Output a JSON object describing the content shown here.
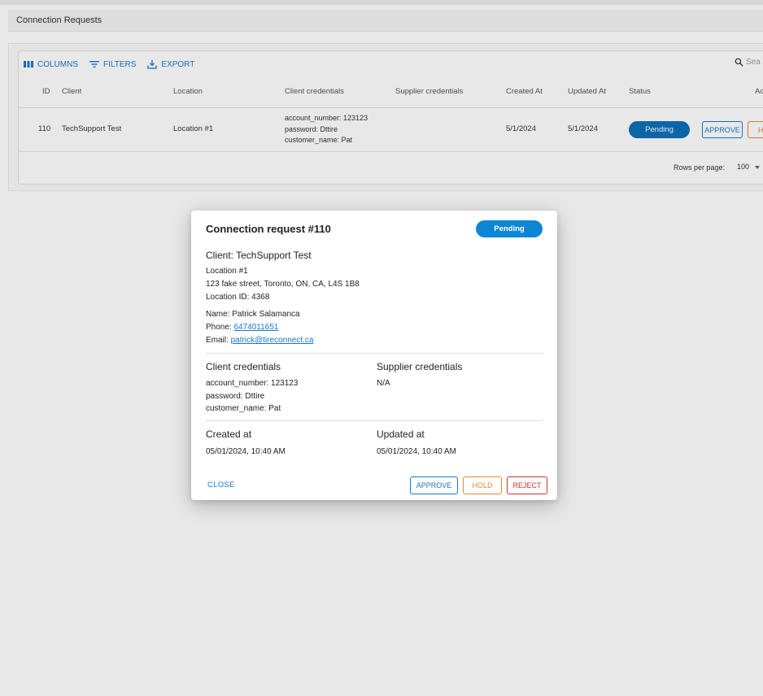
{
  "page": {
    "title": "Connection Requests"
  },
  "toolbar": {
    "columns": "COLUMNS",
    "filters": "FILTERS",
    "export": "EXPORT",
    "search_placeholder": "Sea"
  },
  "table": {
    "headers": {
      "id": "ID",
      "client": "Client",
      "location": "Location",
      "client_credentials": "Client credentials",
      "supplier_credentials": "Supplier credentials",
      "created_at": "Created At",
      "updated_at": "Updated At",
      "status": "Status",
      "actions": "Ac"
    },
    "row": {
      "id": "110",
      "client": "TechSupport Test",
      "location": "Location #1",
      "cred_line1": "account_number: 123123",
      "cred_line2": "password: Dttire",
      "cred_line3": "customer_name: Pat",
      "created_at": "5/1/2024",
      "updated_at": "5/1/2024",
      "status": "Pending",
      "approve": "APPROVE",
      "hold": "H"
    },
    "footer": {
      "rows_per_page_label": "Rows per page:",
      "rows_per_page_value": "100"
    }
  },
  "dialog": {
    "title": "Connection request #110",
    "status": "Pending",
    "client": "Client: TechSupport Test",
    "location_name": "Location #1",
    "address": "123 fake street, Toronto, ON, CA, L4S 1B8",
    "location_id": "Location ID: 4368",
    "name": "Name: Patrick Salamanca",
    "phone_label": "Phone:",
    "phone": "6474011651",
    "email_label": "Email:",
    "email": "patrick@tireconnect.ca",
    "client_credentials_heading": "Client credentials",
    "client_cred_line1": "account_number: 123123",
    "client_cred_line2": "password: Dttire",
    "client_cred_line3": "customer_name: Pat",
    "supplier_credentials_heading": "Supplier credentials",
    "supplier_credentials": "N/A",
    "created_heading": "Created at",
    "created_value": "05/01/2024, 10:40 AM",
    "updated_heading": "Updated at",
    "updated_value": "05/01/2024, 10:40 AM",
    "close": "CLOSE",
    "approve": "APPROVE",
    "hold": "HOLD",
    "reject": "REJECT"
  },
  "colors": {
    "primary": "#1976d2",
    "status_pending": "#0d86d6",
    "hold": "#e08a2e",
    "reject": "#d32f2f"
  }
}
